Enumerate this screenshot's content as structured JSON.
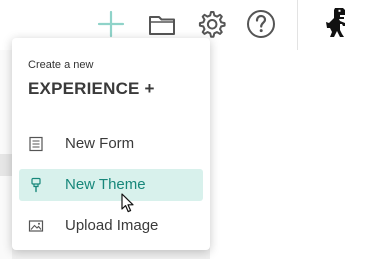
{
  "toolbar": {
    "icons": [
      "add-icon",
      "folder-icon",
      "gear-icon",
      "help-icon",
      "dinosaur-logo"
    ]
  },
  "menu": {
    "caption": "Create a new",
    "title": "EXPERIENCE +",
    "items": [
      {
        "label": "New Form",
        "icon": "form-icon"
      },
      {
        "label": "New Theme",
        "icon": "brush-icon",
        "active": true
      },
      {
        "label": "Upload Image",
        "icon": "image-icon"
      }
    ]
  },
  "colors": {
    "accent": "#17877a",
    "active_background": "#d8f1ec",
    "add_icon": "#8fd3c9"
  }
}
